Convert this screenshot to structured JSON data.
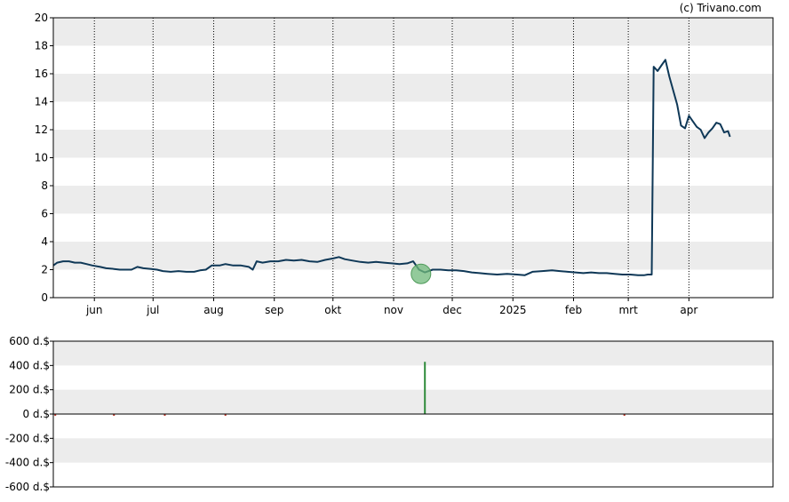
{
  "copyright": "(c) Trivano.com",
  "chart_data": [
    {
      "type": "line",
      "title": "",
      "xlabel": "",
      "ylabel": "",
      "ylim": [
        0,
        20
      ],
      "yticks": [
        0,
        2,
        4,
        6,
        8,
        10,
        12,
        14,
        16,
        18,
        20
      ],
      "grid": "horizontal bands and dotted vertical month lines",
      "line_color": "#0f3857",
      "marker_color": "#6fb87a",
      "month_ticks": [
        {
          "label": "jun",
          "day": 21
        },
        {
          "label": "jul",
          "day": 51
        },
        {
          "label": "aug",
          "day": 82
        },
        {
          "label": "sep",
          "day": 113
        },
        {
          "label": "okt",
          "day": 143
        },
        {
          "label": "nov",
          "day": 174
        },
        {
          "label": "dec",
          "day": 204
        },
        {
          "label": "2025",
          "day": 235
        },
        {
          "label": "feb",
          "day": 266
        },
        {
          "label": "mrt",
          "day": 294
        },
        {
          "label": "apr",
          "day": 325
        }
      ],
      "x_range_days": [
        0,
        368
      ],
      "series": [
        {
          "points": [
            [
              0,
              2.3
            ],
            [
              2,
              2.5
            ],
            [
              5,
              2.6
            ],
            [
              8,
              2.6
            ],
            [
              11,
              2.5
            ],
            [
              14,
              2.5
            ],
            [
              17,
              2.4
            ],
            [
              20,
              2.3
            ],
            [
              24,
              2.2
            ],
            [
              27,
              2.1
            ],
            [
              31,
              2.05
            ],
            [
              34,
              2.0
            ],
            [
              37,
              2.0
            ],
            [
              40,
              2.0
            ],
            [
              43,
              2.2
            ],
            [
              46,
              2.1
            ],
            [
              50,
              2.05
            ],
            [
              53,
              2.0
            ],
            [
              56,
              1.9
            ],
            [
              60,
              1.85
            ],
            [
              64,
              1.9
            ],
            [
              68,
              1.85
            ],
            [
              72,
              1.85
            ],
            [
              75,
              1.95
            ],
            [
              78,
              2.0
            ],
            [
              81,
              2.3
            ],
            [
              85,
              2.3
            ],
            [
              88,
              2.4
            ],
            [
              92,
              2.3
            ],
            [
              96,
              2.3
            ],
            [
              100,
              2.2
            ],
            [
              102,
              2.0
            ],
            [
              104,
              2.6
            ],
            [
              107,
              2.5
            ],
            [
              111,
              2.6
            ],
            [
              115,
              2.6
            ],
            [
              119,
              2.7
            ],
            [
              123,
              2.65
            ],
            [
              127,
              2.7
            ],
            [
              131,
              2.6
            ],
            [
              135,
              2.55
            ],
            [
              139,
              2.7
            ],
            [
              143,
              2.8
            ],
            [
              146,
              2.9
            ],
            [
              149,
              2.75
            ],
            [
              153,
              2.65
            ],
            [
              157,
              2.55
            ],
            [
              161,
              2.5
            ],
            [
              165,
              2.55
            ],
            [
              169,
              2.5
            ],
            [
              173,
              2.45
            ],
            [
              177,
              2.4
            ],
            [
              181,
              2.45
            ],
            [
              184,
              2.6
            ],
            [
              187,
              2.0
            ],
            [
              190,
              1.8
            ],
            [
              194,
              2.0
            ],
            [
              198,
              2.0
            ],
            [
              202,
              1.95
            ],
            [
              206,
              1.95
            ],
            [
              210,
              1.9
            ],
            [
              214,
              1.8
            ],
            [
              218,
              1.75
            ],
            [
              222,
              1.7
            ],
            [
              227,
              1.65
            ],
            [
              232,
              1.7
            ],
            [
              237,
              1.65
            ],
            [
              241,
              1.6
            ],
            [
              245,
              1.85
            ],
            [
              250,
              1.9
            ],
            [
              255,
              1.95
            ],
            [
              259,
              1.9
            ],
            [
              263,
              1.85
            ],
            [
              267,
              1.8
            ],
            [
              271,
              1.75
            ],
            [
              275,
              1.8
            ],
            [
              279,
              1.75
            ],
            [
              283,
              1.75
            ],
            [
              287,
              1.7
            ],
            [
              291,
              1.65
            ],
            [
              295,
              1.65
            ],
            [
              299,
              1.6
            ],
            [
              302,
              1.6
            ],
            [
              304,
              1.65
            ],
            [
              306,
              1.65
            ],
            [
              307,
              16.5
            ],
            [
              309,
              16.2
            ],
            [
              311,
              16.6
            ],
            [
              313,
              17.0
            ],
            [
              315,
              15.8
            ],
            [
              317,
              14.8
            ],
            [
              319,
              13.8
            ],
            [
              321,
              12.3
            ],
            [
              323,
              12.1
            ],
            [
              325,
              13.0
            ],
            [
              327,
              12.6
            ],
            [
              329,
              12.2
            ],
            [
              331,
              12.0
            ],
            [
              333,
              11.4
            ],
            [
              335,
              11.8
            ],
            [
              337,
              12.1
            ],
            [
              339,
              12.5
            ],
            [
              341,
              12.4
            ],
            [
              343,
              11.8
            ],
            [
              345,
              11.9
            ],
            [
              346,
              11.5
            ]
          ]
        }
      ],
      "markers": [
        {
          "day": 188,
          "value": 1.7
        }
      ]
    },
    {
      "type": "bar",
      "title": "",
      "xlabel": "",
      "ylabel": "",
      "ylim": [
        -600,
        600
      ],
      "yticks": [
        "600 d.$",
        "400 d.$",
        "200 d.$",
        "0 d.$",
        "-200 d.$",
        "-400 d.$",
        "-600 d.$"
      ],
      "ytick_values": [
        600,
        400,
        200,
        0,
        -200,
        -400,
        -600
      ],
      "positive_color": "#2e8b3a",
      "negative_color": "#c0392b",
      "bars": [
        {
          "day": 1,
          "value": -6
        },
        {
          "day": 31,
          "value": -6
        },
        {
          "day": 57,
          "value": -6
        },
        {
          "day": 88,
          "value": -8
        },
        {
          "day": 190,
          "value": 430
        },
        {
          "day": 292,
          "value": -5
        }
      ]
    }
  ]
}
